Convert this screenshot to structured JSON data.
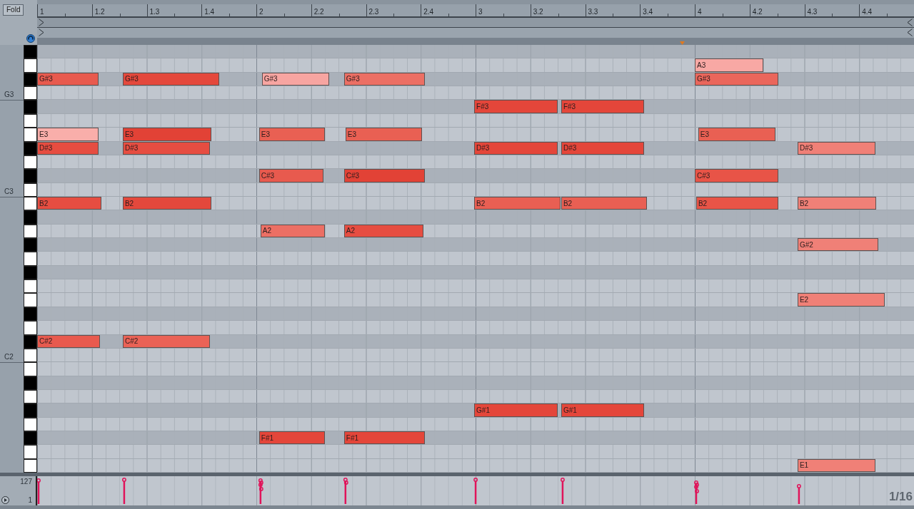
{
  "fold_button": "Fold",
  "ruler": {
    "labels": [
      "1",
      "1.2",
      "1.3",
      "1.4",
      "2",
      "2.2",
      "2.3",
      "2.4",
      "3",
      "3.2",
      "3.3",
      "3.4",
      "4",
      "4.2",
      "4.3",
      "4.4"
    ]
  },
  "rows": [
    {
      "kind": "black"
    },
    {
      "kind": "white",
      "notes": [
        {
          "label": "A3",
          "color": "#f8a8a4"
        }
      ]
    },
    {
      "kind": "black",
      "notes": [
        {
          "label": "G#3",
          "color": "#e85a4e"
        },
        {
          "label": "G#3",
          "color": "#e4483c"
        },
        {
          "label": "G#3",
          "color": "#f7a5a1"
        },
        {
          "label": "G#3",
          "color": "#ec6f64"
        },
        {
          "label": "G#3",
          "color": "#ea665b"
        }
      ]
    },
    {
      "kind": "white",
      "octave": "G3"
    },
    {
      "kind": "black",
      "notes": [
        {
          "label": "F#3",
          "color": "#e4463a"
        },
        {
          "label": "F#3",
          "color": "#e4463a"
        }
      ]
    },
    {
      "kind": "white"
    },
    {
      "kind": "white",
      "notes": [
        {
          "label": "E3",
          "color": "#f9aeaa"
        },
        {
          "label": "E3",
          "color": "#e24236"
        },
        {
          "label": "E3",
          "color": "#e96053"
        },
        {
          "label": "E3",
          "color": "#e96053"
        },
        {
          "label": "E3",
          "color": "#e96053"
        }
      ]
    },
    {
      "kind": "black",
      "notes": [
        {
          "label": "D#3",
          "color": "#e64d41"
        },
        {
          "label": "D#3",
          "color": "#e64d41"
        },
        {
          "label": "D#3",
          "color": "#e4463a"
        },
        {
          "label": "D#3",
          "color": "#e4463a"
        },
        {
          "label": "D#3",
          "color": "#f08077"
        }
      ]
    },
    {
      "kind": "white"
    },
    {
      "kind": "black",
      "notes": [
        {
          "label": "C#3",
          "color": "#e85a4e"
        },
        {
          "label": "C#3",
          "color": "#e24236"
        },
        {
          "label": "C#3",
          "color": "#e85447"
        }
      ]
    },
    {
      "kind": "white",
      "octave": "C3"
    },
    {
      "kind": "white",
      "notes": [
        {
          "label": "B2",
          "color": "#e64d41"
        },
        {
          "label": "B2",
          "color": "#e4483c"
        },
        {
          "label": "B2",
          "color": "#e95f53"
        },
        {
          "label": "B2",
          "color": "#e95f53"
        },
        {
          "label": "B2",
          "color": "#e85447"
        },
        {
          "label": "B2",
          "color": "#f08077"
        }
      ]
    },
    {
      "kind": "black"
    },
    {
      "kind": "white",
      "notes": [
        {
          "label": "A2",
          "color": "#ec6f64"
        },
        {
          "label": "A2",
          "color": "#e64d41"
        }
      ]
    },
    {
      "kind": "black",
      "notes": [
        {
          "label": "G#2",
          "color": "#f08077"
        }
      ]
    },
    {
      "kind": "white"
    },
    {
      "kind": "black"
    },
    {
      "kind": "white"
    },
    {
      "kind": "white",
      "notes": [
        {
          "label": "E2",
          "color": "#f08077"
        }
      ]
    },
    {
      "kind": "black"
    },
    {
      "kind": "white"
    },
    {
      "kind": "black",
      "notes": [
        {
          "label": "C#2",
          "color": "#e85a4e"
        },
        {
          "label": "C#2",
          "color": "#ea6256"
        }
      ]
    },
    {
      "kind": "white",
      "octave": "C2"
    },
    {
      "kind": "white"
    },
    {
      "kind": "black"
    },
    {
      "kind": "white"
    },
    {
      "kind": "black",
      "notes": [
        {
          "label": "G#1",
          "color": "#e4463a"
        },
        {
          "label": "G#1",
          "color": "#e4463a"
        }
      ]
    },
    {
      "kind": "white"
    },
    {
      "kind": "black",
      "notes": [
        {
          "label": "F#1",
          "color": "#e4463a"
        },
        {
          "label": "F#1",
          "color": "#e4463a"
        }
      ]
    },
    {
      "kind": "white"
    },
    {
      "kind": "white",
      "notes": [
        {
          "label": "E1",
          "color": "#f08077"
        }
      ]
    }
  ],
  "velocity_lane": {
    "max_label": "127",
    "min_label": "1"
  },
  "grid_label": "1/16"
}
